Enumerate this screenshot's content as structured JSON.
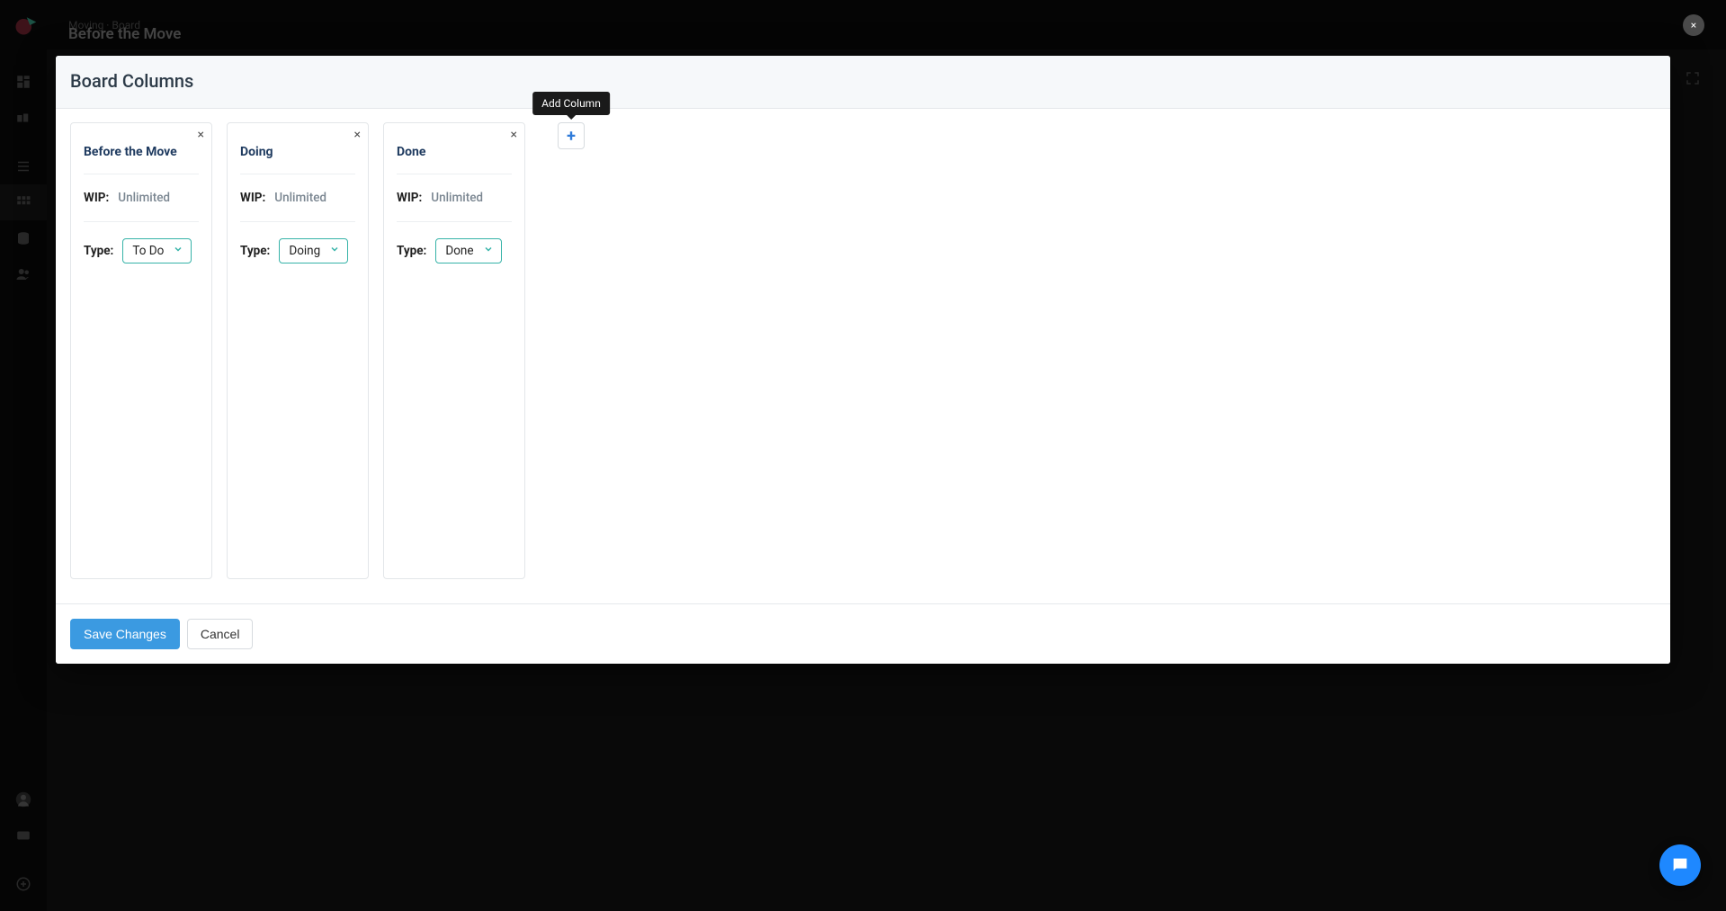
{
  "header": {
    "breadcrumb": "Moving · Board",
    "title": "Before the Move"
  },
  "modal": {
    "title": "Board Columns",
    "wip_label": "WIP:",
    "type_label": "Type:",
    "columns": [
      {
        "name": "Before the Move",
        "wip": "Unlimited",
        "type": "To Do"
      },
      {
        "name": "Doing",
        "wip": "Unlimited",
        "type": "Doing"
      },
      {
        "name": "Done",
        "wip": "Unlimited",
        "type": "Done"
      }
    ],
    "add_column_tooltip": "Add Column",
    "save_label": "Save Changes",
    "cancel_label": "Cancel"
  },
  "icons": {
    "close": "×",
    "plus": "+"
  }
}
